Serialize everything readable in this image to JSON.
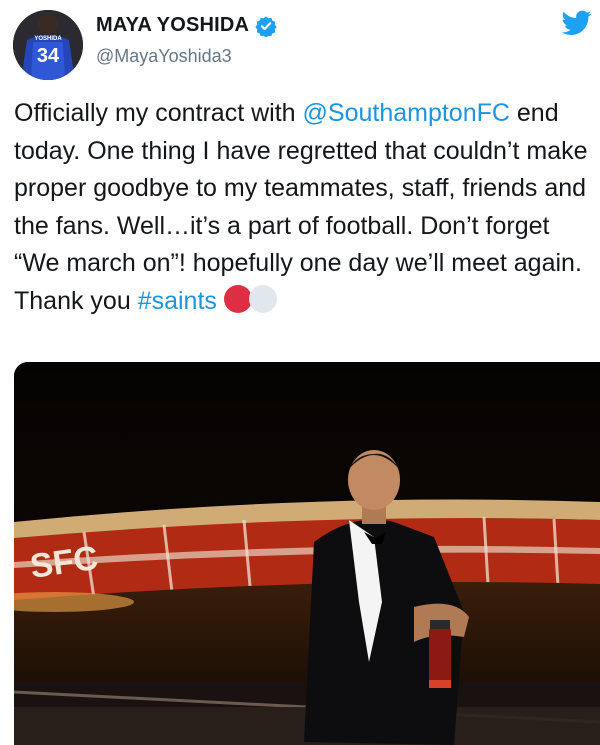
{
  "user": {
    "name": "MAYA YOSHIDA",
    "handle": "@MayaYoshida3",
    "jersey_text": "YOSHIDA",
    "jersey_number": "34"
  },
  "tweet": {
    "t1": "Officially my contract with ",
    "mention": "@SouthamptonFC",
    "t2": " end today. One thing I have regretted that couldn’t make proper goodbye to my teammates, staff, friends and the fans. Well…it’s a part of football. Don’t forget “We march on”! hopefully one day we’ll meet again. Thank you ",
    "hashtag": "#saints"
  },
  "photo": {
    "stadium_lettering": "SFC"
  },
  "colors": {
    "link": "#1b95e0",
    "verified": "#1da1f2",
    "red_circle": "#dd2e44",
    "white_circle": "#e1e8ed"
  },
  "icons": [
    "verified-badge-icon",
    "twitter-bird-icon",
    "red-circle-emoji",
    "white-circle-emoji"
  ]
}
